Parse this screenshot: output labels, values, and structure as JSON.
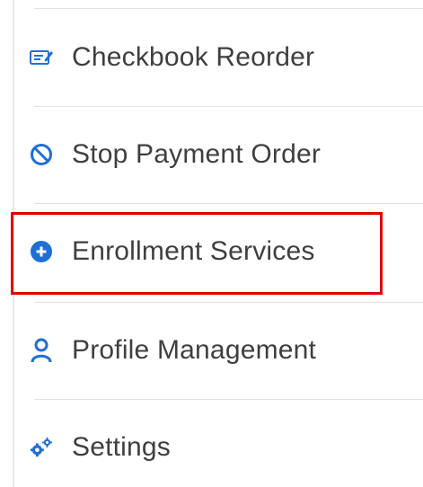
{
  "menu": {
    "items": [
      {
        "label": "Checkbook Reorder",
        "icon": "checkbook-icon"
      },
      {
        "label": "Stop Payment Order",
        "icon": "prohibited-icon"
      },
      {
        "label": "Enrollment Services",
        "icon": "plus-circle-icon"
      },
      {
        "label": "Profile Management",
        "icon": "person-icon"
      },
      {
        "label": "Settings",
        "icon": "gears-icon"
      }
    ],
    "highlighted_item": "Enrollment Services"
  },
  "colors": {
    "icon_blue": "#1f6fd6",
    "text": "#3f3f3f",
    "highlight_border": "#e00000",
    "divider": "#e2e2e2"
  }
}
